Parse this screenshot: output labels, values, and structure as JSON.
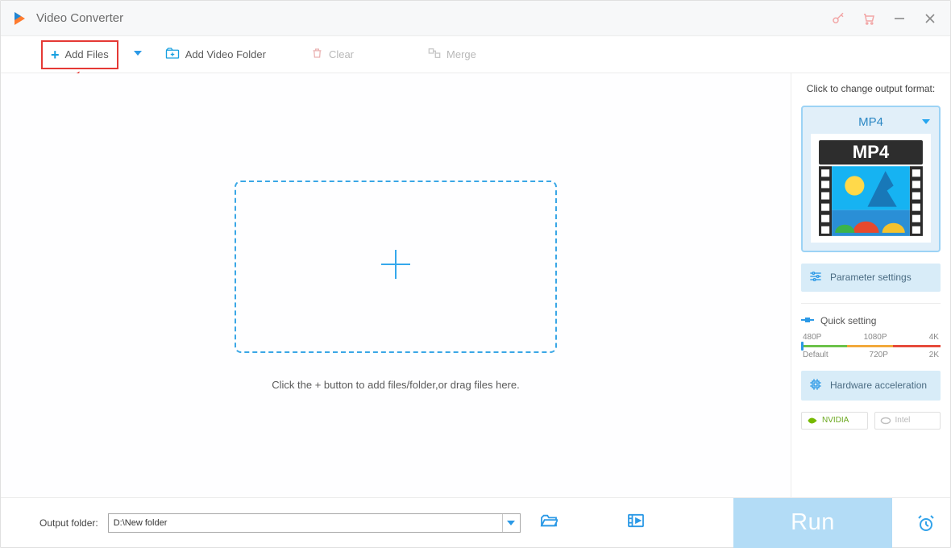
{
  "titlebar": {
    "title": "Video Converter"
  },
  "toolbar": {
    "add_files": "Add Files",
    "add_folder": "Add Video Folder",
    "clear": "Clear",
    "merge": "Merge"
  },
  "main": {
    "hint": "Click the + button to add files/folder,or drag files here."
  },
  "side": {
    "change_format_label": "Click to change output format:",
    "format_name": "MP4",
    "thumb_label": "MP4",
    "parameter_settings": "Parameter settings",
    "quick_setting": "Quick setting",
    "quality_top": [
      "480P",
      "1080P",
      "4K"
    ],
    "quality_bottom": [
      "Default",
      "720P",
      "2K"
    ],
    "hardware_accel": "Hardware acceleration",
    "vendors": {
      "nvidia": "NVIDIA",
      "intel": "Intel"
    }
  },
  "bottom": {
    "output_folder_label": "Output folder:",
    "output_path": "D:\\New folder",
    "run": "Run"
  }
}
